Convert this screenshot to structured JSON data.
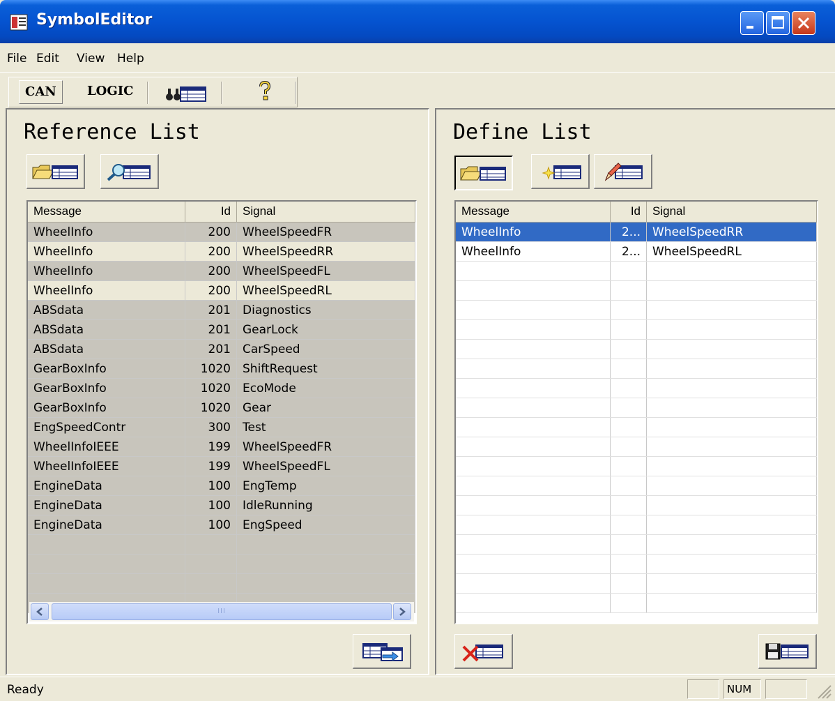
{
  "window": {
    "title": "SymbolEditor"
  },
  "menu": [
    "File",
    "Edit",
    "View",
    "Help"
  ],
  "toolbar": {
    "can_label": "CAN",
    "logic_label": "LOGIC"
  },
  "reference": {
    "title": "Reference List",
    "columns": [
      "Message",
      "Id",
      "Signal"
    ],
    "rows": [
      [
        "WheelInfo",
        "200",
        "WheelSpeedFR"
      ],
      [
        "WheelInfo",
        "200",
        "WheelSpeedRR"
      ],
      [
        "WheelInfo",
        "200",
        "WheelSpeedFL"
      ],
      [
        "WheelInfo",
        "200",
        "WheelSpeedRL"
      ],
      [
        "ABSdata",
        "201",
        "Diagnostics"
      ],
      [
        "ABSdata",
        "201",
        "GearLock"
      ],
      [
        "ABSdata",
        "201",
        "CarSpeed"
      ],
      [
        "GearBoxInfo",
        "1020",
        "ShiftRequest"
      ],
      [
        "GearBoxInfo",
        "1020",
        "EcoMode"
      ],
      [
        "GearBoxInfo",
        "1020",
        "Gear"
      ],
      [
        "EngSpeedContr",
        "300",
        "Test"
      ],
      [
        "WheelInfoIEEE",
        "199",
        "WheelSpeedFR"
      ],
      [
        "WheelInfoIEEE",
        "199",
        "WheelSpeedFL"
      ],
      [
        "EngineData",
        "100",
        "EngTemp"
      ],
      [
        "EngineData",
        "100",
        "IdleRunning"
      ],
      [
        "EngineData",
        "100",
        "EngSpeed"
      ]
    ]
  },
  "define": {
    "title": "Define List",
    "columns": [
      "Message",
      "Id",
      "Signal"
    ],
    "rows": [
      [
        "WheelInfo",
        "2...",
        "WheelSpeedRR"
      ],
      [
        "WheelInfo",
        "2...",
        "WheelSpeedRL"
      ]
    ],
    "selected_row": 0
  },
  "scrollbar": {
    "thumb_grip": "III"
  },
  "status": {
    "text": "Ready",
    "num": "NUM"
  },
  "colors": {
    "titlebar": "#0553d0",
    "selection": "#316ac5",
    "face": "#ece9d8"
  },
  "icons": {
    "open_ref": "open-folder-table-icon",
    "find_ref": "magnifier-table-icon",
    "transfer": "transfer-table-icon",
    "open_def": "open-folder-table-icon",
    "new_def": "new-table-icon",
    "edit_def": "edit-table-icon",
    "delete_def": "delete-table-icon",
    "save_def": "save-table-icon",
    "find_toolbar": "binoculars-table-icon",
    "help": "help-icon"
  }
}
